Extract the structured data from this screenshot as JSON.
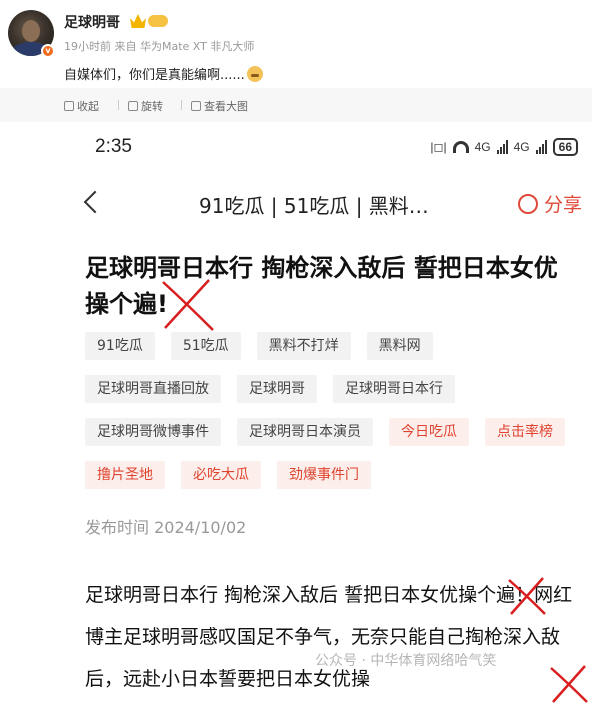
{
  "post": {
    "username": "足球明哥",
    "meta": "19小时前  来自 华为Mate XT 非凡大师",
    "text": "自媒体们，你们是真能编啊......",
    "avatar_badge": "v"
  },
  "toolbar": {
    "collapse": "收起",
    "rotate": "旋转",
    "view_large": "查看大图"
  },
  "screenshot": {
    "status_time": "2:35",
    "signal_label_1": "4G",
    "signal_label_2": "4G",
    "battery": "66",
    "nav_title": "91吃瓜 | 51吃瓜 | 黑料…",
    "share_label": "分享",
    "title": "足球明哥日本行 掏枪深入敌后 誓把日本女优操个遍!",
    "tag_rows": [
      [
        {
          "label": "91吃瓜",
          "hot": false
        },
        {
          "label": "51吃瓜",
          "hot": false
        },
        {
          "label": "黑料不打烊",
          "hot": false
        },
        {
          "label": "黑料网",
          "hot": false
        }
      ],
      [
        {
          "label": "足球明哥直播回放",
          "hot": false
        },
        {
          "label": "足球明哥",
          "hot": false
        },
        {
          "label": "足球明哥日本行",
          "hot": false
        }
      ],
      [
        {
          "label": "足球明哥微博事件",
          "hot": false
        },
        {
          "label": "足球明哥日本演员",
          "hot": false
        },
        {
          "label": "今日吃瓜",
          "hot": true
        },
        {
          "label": "点击率榜",
          "hot": true
        }
      ],
      [
        {
          "label": "撸片圣地",
          "hot": true
        },
        {
          "label": "必吃大瓜",
          "hot": true
        },
        {
          "label": "劲爆事件门",
          "hot": true
        }
      ]
    ],
    "pub_date": "发布时间  2024/10/02",
    "body": "足球明哥日本行 掏枪深入敌后 誓把日本女优操个遍！网红博主足球明哥感叹国足不争气，无奈只能自己掏枪深入敌后，远赴小日本誓要把日本女优操",
    "watermark": "公众号 · 中华体育网络哈气笑",
    "accent_color": "#e0432f"
  }
}
